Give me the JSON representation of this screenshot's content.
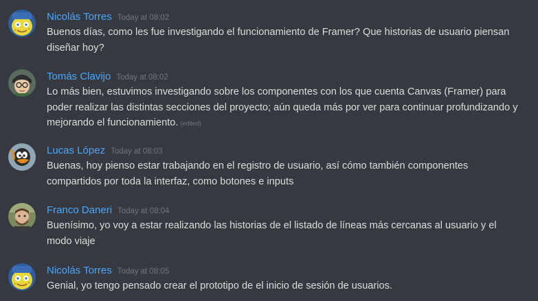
{
  "messages": [
    {
      "author": "Nicolás Torres",
      "timestamp": "Today at 08:02",
      "text": "Buenos días, como les fue investigando el funcionamiento de Framer? Que historias de usuario piensan diseñar hoy?",
      "edited": ""
    },
    {
      "author": "Tomás Clavijo",
      "timestamp": "Today at 08:02",
      "text": "Lo más bien, estuvimos investigando sobre los componentes con los que cuenta Canvas (Framer) para poder realizar las distintas secciones del proyecto; aún queda más por ver para continuar profundizando y mejorando el funcionamiento.",
      "edited": "(edited)"
    },
    {
      "author": "Lucas López",
      "timestamp": "Today at 08:03",
      "text": "Buenas, hoy pienso estar trabajando en el registro de usuario, así cómo también componentes compartidos por toda la interfaz, como botones e inputs",
      "edited": ""
    },
    {
      "author": "Franco Daneri",
      "timestamp": "Today at 08:04",
      "text": "Buenísimo, yo voy a estar realizando las historias de el listado de líneas más cercanas al usuario y el modo viaje",
      "edited": ""
    },
    {
      "author": "Nicolás Torres",
      "timestamp": "Today at 08:05",
      "text": "Genial, yo tengo pensado crear el prototipo de el inicio de sesión de usuarios.",
      "edited": ""
    }
  ],
  "colors": {
    "background": "#36393f",
    "author": "#4aa8ff",
    "text": "#dcddde",
    "muted": "#72767d"
  }
}
